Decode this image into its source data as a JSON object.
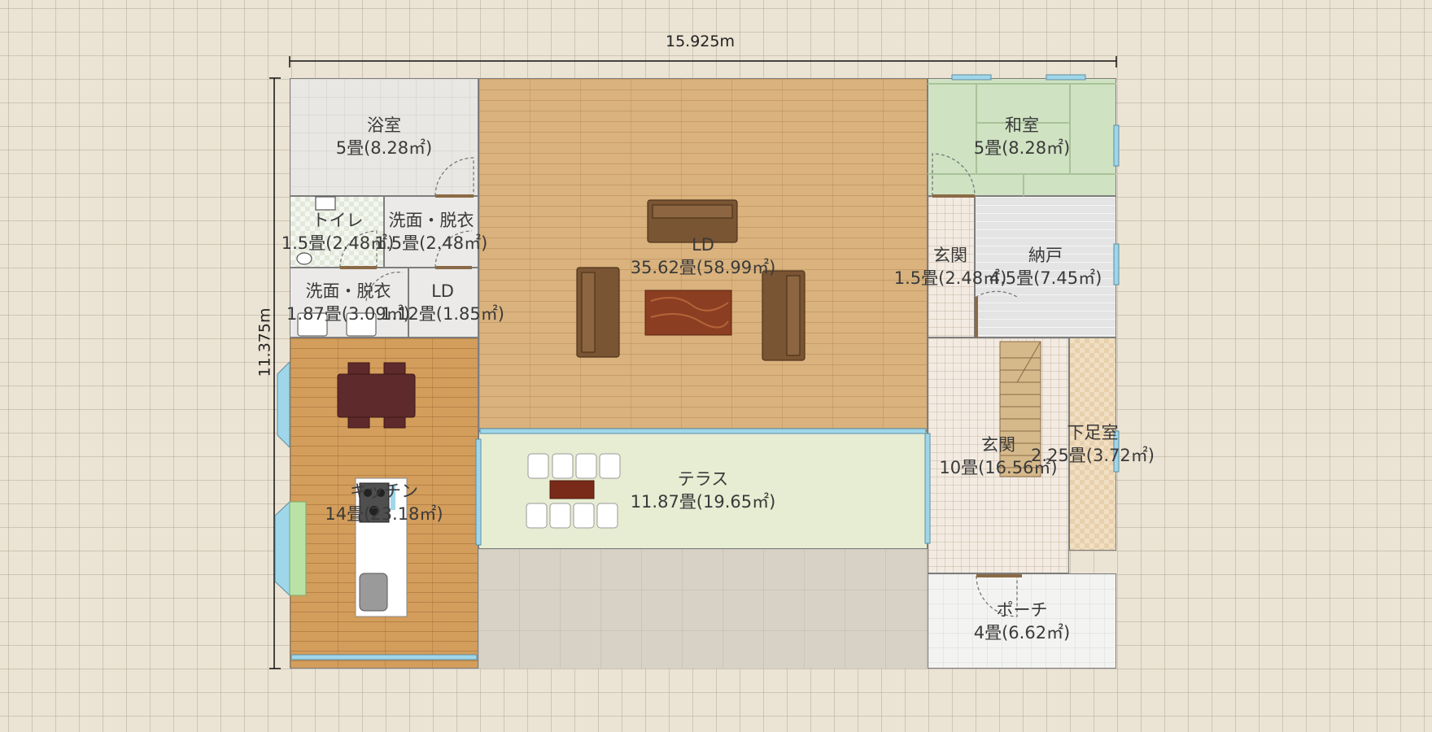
{
  "dimensions": {
    "width_label": "15.925m",
    "height_label": "11.375m"
  },
  "rooms": {
    "bathroom": {
      "name": "浴室",
      "size": "5畳(8.28㎡)"
    },
    "toilet": {
      "name": "トイレ",
      "size": "1.5畳(2.48㎡)"
    },
    "washroom_1": {
      "name": "洗面・脱衣",
      "size": "1.5畳(2.48㎡)"
    },
    "washroom_2": {
      "name": "洗面・脱衣",
      "size": "1.87畳(3.09㎡)"
    },
    "ld_small": {
      "name": "LD",
      "size": "1.12畳(1.85㎡)"
    },
    "ld_main": {
      "name": "LD",
      "size": "35.62畳(58.99㎡)"
    },
    "kitchen": {
      "name": "キッチン",
      "size": "14畳(23.18㎡)"
    },
    "terrace": {
      "name": "テラス",
      "size": "11.87畳(19.65㎡)"
    },
    "washitsu": {
      "name": "和室",
      "size": "5畳(8.28㎡)"
    },
    "genkan_small": {
      "name": "玄関",
      "size": "1.5畳(2.48㎡)"
    },
    "nando": {
      "name": "納戸",
      "size": "4.5畳(7.45㎡)"
    },
    "genkan_main": {
      "name": "玄関",
      "size": "10畳(16.56㎡)"
    },
    "shoe_room": {
      "name": "下足室",
      "size": "2.25畳(3.72㎡)"
    },
    "porch": {
      "name": "ポーチ",
      "size": "4畳(6.62㎡)"
    }
  },
  "colors": {
    "wall": "#7d7d7d",
    "window": "#9fd6ea",
    "furniture_brown": "#7a5533",
    "table_dark": "#5e2a2c"
  }
}
